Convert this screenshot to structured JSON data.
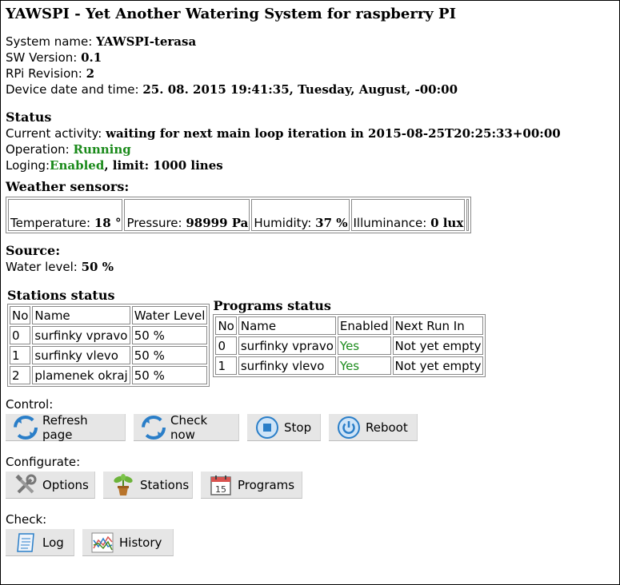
{
  "title": "YAWSPI - Yet Another Watering System for raspberry PI",
  "system": {
    "name_label": "System name:",
    "name_value": "YAWSPI-terasa",
    "sw_label": "SW Version:",
    "sw_value": "0.1",
    "rpi_label": "RPi Revision:",
    "rpi_value": "2",
    "dt_label": "Device date and time:",
    "dt_value": "25. 08. 2015 19:41:35, Tuesday, August, -00:00"
  },
  "status": {
    "heading": "Status",
    "activity_label": "Current activity:",
    "activity_value": "waiting for next main loop iteration in 2015-08-25T20:25:33+00:00",
    "operation_label": "Operation:",
    "operation_value": "Running",
    "loging_label": "Loging:",
    "loging_value": "Enabled",
    "loging_limit": ", limit: 1000 lines"
  },
  "weather": {
    "heading": "Weather sensors:",
    "sensors": [
      {
        "label": "Temperature:",
        "value": "18 °"
      },
      {
        "label": "Pressure:",
        "value": "98999 Pa"
      },
      {
        "label": "Humidity:",
        "value": "37 %"
      },
      {
        "label": "Illuminance:",
        "value": "0 lux"
      }
    ]
  },
  "source": {
    "heading": "Source:",
    "level_label": "Water level:",
    "level_value": "50 %"
  },
  "stations": {
    "heading": "Stations status",
    "headers": [
      "No",
      "Name",
      "Water Level"
    ],
    "rows": [
      [
        "0",
        "surfinky vpravo",
        "50 %"
      ],
      [
        "1",
        "surfinky vlevo",
        "50 %"
      ],
      [
        "2",
        "plamenek okraj",
        "50 %"
      ]
    ]
  },
  "programs": {
    "heading": "Programs status",
    "headers": [
      "No",
      "Name",
      "Enabled",
      "Next Run In"
    ],
    "rows": [
      [
        "0",
        "surfinky vpravo",
        "Yes",
        "Not yet empty"
      ],
      [
        "1",
        "surfinky vlevo",
        "Yes",
        "Not yet empty"
      ]
    ]
  },
  "control": {
    "label": "Control:",
    "buttons": [
      {
        "label": "Refresh page",
        "icon": "refresh-icon"
      },
      {
        "label": "Check now",
        "icon": "check-now-icon"
      },
      {
        "label": "Stop",
        "icon": "stop-icon"
      },
      {
        "label": "Reboot",
        "icon": "power-icon"
      }
    ]
  },
  "configurate": {
    "label": "Configurate:",
    "buttons": [
      {
        "label": "Options",
        "icon": "tools-icon"
      },
      {
        "label": "Stations",
        "icon": "plant-icon"
      },
      {
        "label": "Programs",
        "icon": "calendar-icon",
        "calendar_day": "15"
      }
    ]
  },
  "check": {
    "label": "Check:",
    "buttons": [
      {
        "label": "Log",
        "icon": "scroll-icon"
      },
      {
        "label": "History",
        "icon": "chart-icon"
      }
    ]
  },
  "colors": {
    "green": "#1a8a1a",
    "button_bg": "#e6e6e6",
    "icon_blue": "#2a7ec8"
  }
}
